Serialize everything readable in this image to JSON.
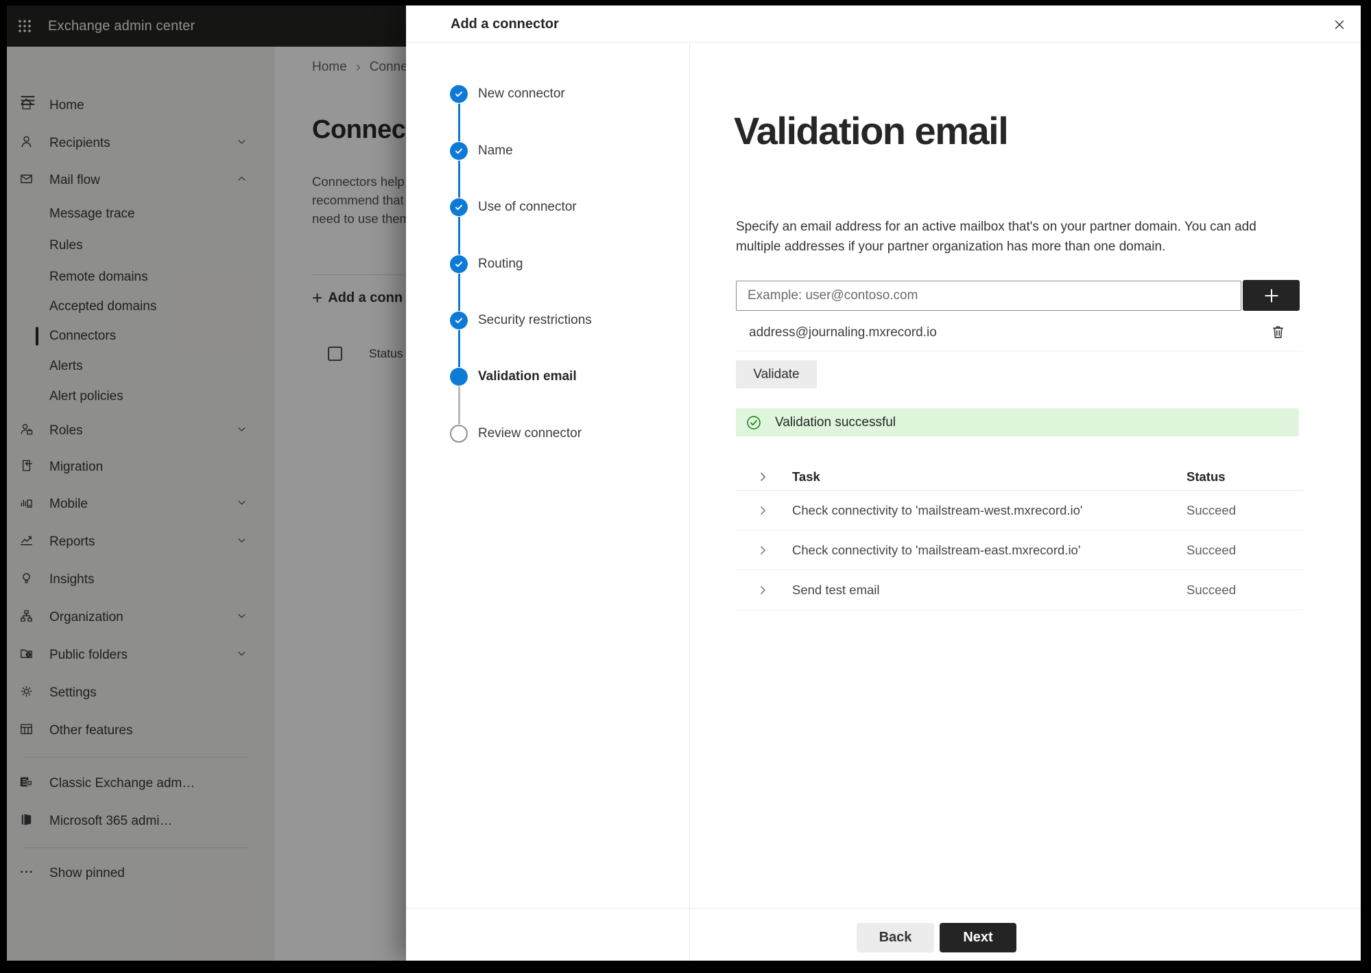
{
  "colors": {
    "accent": "#0d7ad5",
    "success": "#107c10",
    "success_bg": "#dff6dd",
    "dark_button": "#242424"
  },
  "app_header": {
    "title": "Exchange admin center"
  },
  "sidebar": {
    "items": [
      {
        "label": "Home",
        "icon": "home-icon"
      },
      {
        "label": "Recipients",
        "icon": "person-icon",
        "chevron": "down"
      },
      {
        "label": "Mail flow",
        "icon": "mail-icon",
        "chevron": "up"
      },
      {
        "label": "Message trace",
        "sub": true
      },
      {
        "label": "Rules",
        "sub": true
      },
      {
        "label": "Remote domains",
        "sub": true
      },
      {
        "label": "Accepted domains",
        "sub": true
      },
      {
        "label": "Connectors",
        "sub": true,
        "selected": true
      },
      {
        "label": "Alerts",
        "sub": true
      },
      {
        "label": "Alert policies",
        "sub": true
      },
      {
        "label": "Roles",
        "icon": "roles-icon",
        "chevron": "down"
      },
      {
        "label": "Migration",
        "icon": "migration-icon"
      },
      {
        "label": "Mobile",
        "icon": "mobile-icon",
        "chevron": "down"
      },
      {
        "label": "Reports",
        "icon": "reports-icon",
        "chevron": "down"
      },
      {
        "label": "Insights",
        "icon": "lightbulb-icon"
      },
      {
        "label": "Organization",
        "icon": "org-icon",
        "chevron": "down"
      },
      {
        "label": "Public folders",
        "icon": "folder-globe-icon",
        "chevron": "down"
      },
      {
        "label": "Settings",
        "icon": "gear-icon"
      },
      {
        "label": "Other features",
        "icon": "grid-table-icon"
      }
    ],
    "footer_items": [
      {
        "label": "Classic Exchange adm…",
        "icon": "exchange-logo-icon"
      },
      {
        "label": "Microsoft 365 admi…",
        "icon": "m365-logo-icon"
      }
    ],
    "show_pinned": "Show pinned"
  },
  "page": {
    "breadcrumb": [
      "Home",
      "Conne"
    ],
    "title": "Connect",
    "description_lines": [
      "Connectors help",
      "recommend that",
      "need to use them"
    ],
    "add_button": "Add a conn",
    "status_header": "Status"
  },
  "dialog": {
    "title": "Add a connector",
    "steps": [
      {
        "label": "New connector",
        "state": "done"
      },
      {
        "label": "Name",
        "state": "done"
      },
      {
        "label": "Use of connector",
        "state": "done"
      },
      {
        "label": "Routing",
        "state": "done"
      },
      {
        "label": "Security restrictions",
        "state": "done"
      },
      {
        "label": "Validation email",
        "state": "current"
      },
      {
        "label": "Review connector",
        "state": "upcoming"
      }
    ],
    "heading": "Validation email",
    "description": "Specify an email address for an active mailbox that's on your partner domain. You can add multiple addresses if your partner organization has more than one domain.",
    "email_input": {
      "placeholder": "Example: user@contoso.com"
    },
    "added_address": "address@journaling.mxrecord.io",
    "validate_button": "Validate",
    "banner_text": "Validation successful",
    "table": {
      "columns": [
        "Task",
        "Status"
      ],
      "rows": [
        {
          "task": "Check connectivity to 'mailstream-west.mxrecord.io'",
          "status": "Succeed"
        },
        {
          "task": "Check connectivity to 'mailstream-east.mxrecord.io'",
          "status": "Succeed"
        },
        {
          "task": "Send test email",
          "status": "Succeed"
        }
      ]
    },
    "back_button": "Back",
    "next_button": "Next"
  }
}
